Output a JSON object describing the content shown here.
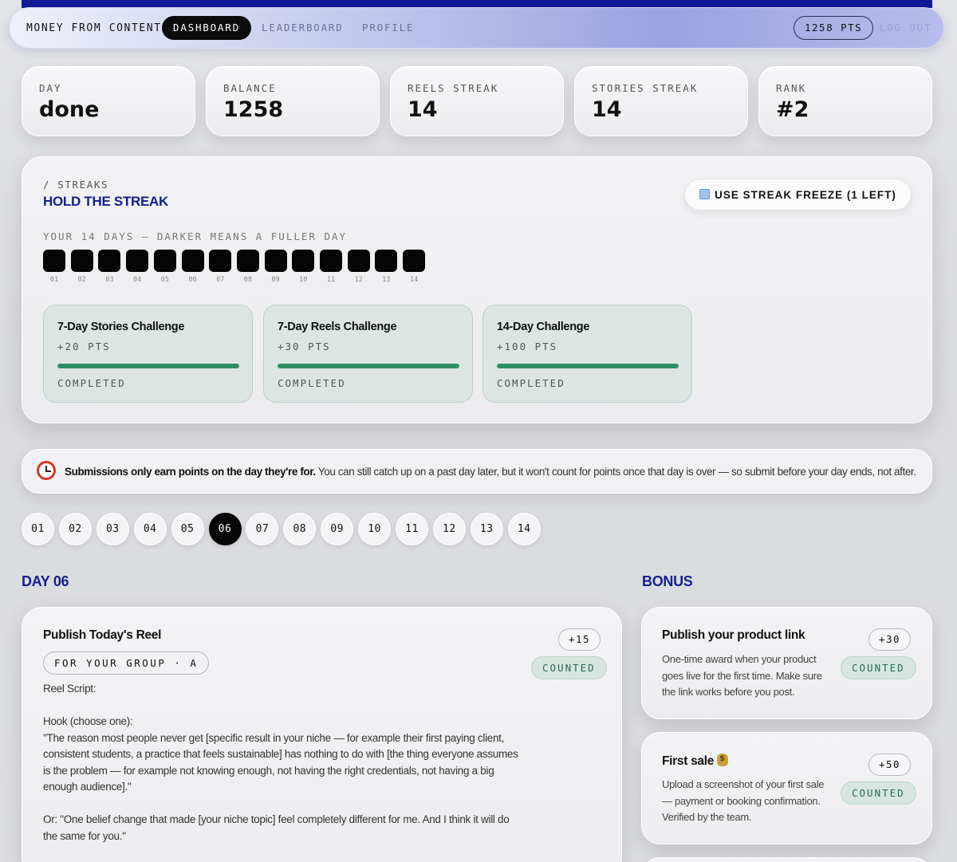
{
  "nav": {
    "brand": "MONEY FROM CONTENT",
    "tabs": [
      "DASHBOARD",
      "LEADERBOARD",
      "PROFILE"
    ],
    "active_tab": "DASHBOARD",
    "points": "1258 PTS",
    "logout": "LOG OUT"
  },
  "stats": [
    {
      "label": "DAY",
      "value": "done"
    },
    {
      "label": "BALANCE",
      "value": "1258"
    },
    {
      "label": "REELS STREAK",
      "value": "14"
    },
    {
      "label": "STORIES STREAK",
      "value": "14"
    },
    {
      "label": "RANK",
      "value": "#2"
    }
  ],
  "streaks": {
    "kicker": "/ STREAKS",
    "title": "HOLD THE STREAK",
    "freeze_button": "USE STREAK FREEZE (1 LEFT)",
    "freeze_icon": "ice-cube-icon",
    "days_caption": "YOUR 14 DAYS — DARKER MEANS A FULLER DAY",
    "days": [
      "01",
      "02",
      "03",
      "04",
      "05",
      "06",
      "07",
      "08",
      "09",
      "10",
      "11",
      "12",
      "13",
      "14"
    ],
    "challenges": [
      {
        "title": "7-Day Stories Challenge",
        "points": "+20 PTS",
        "progress": 1.0,
        "status": "COMPLETED"
      },
      {
        "title": "7-Day Reels Challenge",
        "points": "+30 PTS",
        "progress": 1.0,
        "status": "COMPLETED"
      },
      {
        "title": "14-Day Challenge",
        "points": "+100 PTS",
        "progress": 1.0,
        "status": "COMPLETED"
      }
    ]
  },
  "notice": {
    "icon": "alarm-clock-icon",
    "bold": "Submissions only earn points on the day they're for.",
    "text": " You can still catch up on a past day later, but it won't count for points once that day is over — so submit before your day ends, not after."
  },
  "day_selector": {
    "days": [
      "01",
      "02",
      "03",
      "04",
      "05",
      "06",
      "07",
      "08",
      "09",
      "10",
      "11",
      "12",
      "13",
      "14"
    ],
    "active": "06"
  },
  "day_section": {
    "title": "DAY 06",
    "task": {
      "title": "Publish Today's Reel",
      "group": "FOR YOUR GROUP · A",
      "points": "+15",
      "status": "COUNTED",
      "body": "Reel Script:\n\nHook (choose one):\n\"The reason most people never get [specific result in your niche — for example their first paying client, consistent students, a practice that feels sustainable] has nothing to do with [the thing everyone assumes is the problem — for example not knowing enough, not having the right credentials, not having a big enough audience].\"\n\nOr: \"One belief change that made [your niche topic] feel completely different for me. And I think it will do the same for you.\""
    }
  },
  "bonus": {
    "title": "BONUS",
    "items": [
      {
        "title": "Publish your product link",
        "points": "+30",
        "status": "COUNTED",
        "desc": "One-time award when your product goes live for the first time. Make sure the link works before you post."
      },
      {
        "title": "First sale",
        "icon": "money-bag-icon",
        "points": "+50",
        "status": "COUNTED",
        "desc": "Upload a screenshot of your first sale — payment or booking confirmation. Verified by the team."
      }
    ]
  },
  "colors": {
    "accent": "#14208c",
    "success": "#2e8f66",
    "active": "#080808"
  }
}
